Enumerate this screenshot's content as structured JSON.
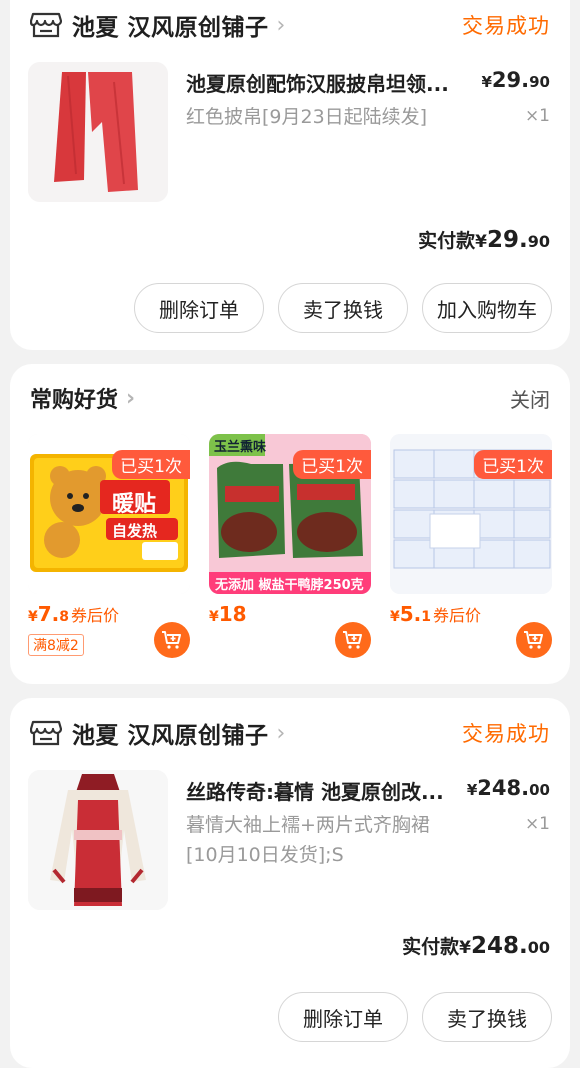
{
  "order1": {
    "shop_name": "池夏 汉风原创铺子",
    "status": "交易成功",
    "title": "池夏原创配饰汉服披帛坦领...",
    "price_symbol": "¥",
    "price_int": "29.",
    "price_dec": "90",
    "sku": "红色披帛[9月23日起陆续发]",
    "qty": "×1",
    "paid_label": "实付款",
    "paid_symbol": "¥",
    "paid_int": "29.",
    "paid_dec": "90",
    "btn_delete": "删除订单",
    "btn_sell": "卖了换钱",
    "btn_cart": "加入购物车"
  },
  "frequent": {
    "title": "常购好货",
    "close": "关闭",
    "items": [
      {
        "badge": "已买1次",
        "price_int": "7.",
        "price_dec": "8",
        "tag": "券后价",
        "coupon": "满8减2",
        "image_text_1": "暖贴",
        "image_text_2": "自发热"
      },
      {
        "badge": "已买1次",
        "price_int": "18",
        "price_dec": "",
        "tag": "",
        "coupon": "",
        "image_top": "玉兰熏味",
        "image_bottom": "无添加 椒盐干鸭脖250克"
      },
      {
        "badge": "已买1次",
        "price_int": "5.",
        "price_dec": "1",
        "tag": "券后价",
        "coupon": ""
      }
    ],
    "price_symbol": "¥"
  },
  "order2": {
    "shop_name": "池夏 汉风原创铺子",
    "status": "交易成功",
    "title": "丝路传奇:暮情 池夏原创改...",
    "price_symbol": "¥",
    "price_int": "248.",
    "price_dec": "00",
    "sku_line1": "暮情大袖上襦+两片式齐胸裙",
    "sku_line2": "[10月10日发货];S",
    "qty": "×1",
    "paid_label": "实付款",
    "paid_symbol": "¥",
    "paid_int": "248.",
    "paid_dec": "00",
    "btn_delete": "删除订单",
    "btn_sell": "卖了换钱"
  },
  "colors": {
    "accent": "#ff6a00",
    "badge": "#ff5a3c",
    "background": "#f2f2f2"
  }
}
